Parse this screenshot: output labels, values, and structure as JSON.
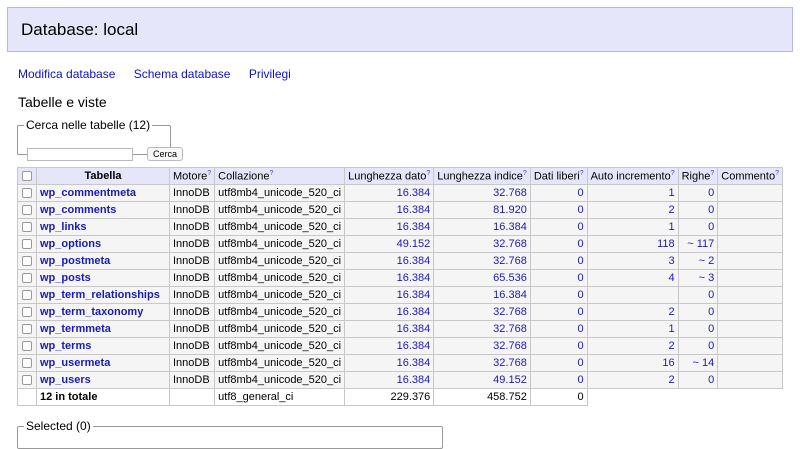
{
  "header": {
    "title": "Database: local"
  },
  "nav": {
    "modify": "Modifica database",
    "schema": "Schema database",
    "privileges": "Privilegi"
  },
  "section_title": "Tabelle e viste",
  "search": {
    "legend": "Cerca nelle tabelle (12)",
    "value": "",
    "button": "Cerca"
  },
  "table": {
    "headers": {
      "table": "Tabella",
      "engine": "Motore",
      "collation": "Collazione",
      "data_length": "Lunghezza dato",
      "index_length": "Lunghezza indice",
      "data_free": "Dati liberi",
      "auto_increment": "Auto incremento",
      "rows": "Righe",
      "comment": "Commento",
      "help": "?"
    },
    "rows": [
      {
        "name": "wp_commentmeta",
        "engine": "InnoDB",
        "collation": "utf8mb4_unicode_520_ci",
        "data": "16.384",
        "index": "32.768",
        "free": "0",
        "auto": "1",
        "rows": "0"
      },
      {
        "name": "wp_comments",
        "engine": "InnoDB",
        "collation": "utf8mb4_unicode_520_ci",
        "data": "16.384",
        "index": "81.920",
        "free": "0",
        "auto": "2",
        "rows": "0"
      },
      {
        "name": "wp_links",
        "engine": "InnoDB",
        "collation": "utf8mb4_unicode_520_ci",
        "data": "16.384",
        "index": "16.384",
        "free": "0",
        "auto": "1",
        "rows": "0"
      },
      {
        "name": "wp_options",
        "engine": "InnoDB",
        "collation": "utf8mb4_unicode_520_ci",
        "data": "49.152",
        "index": "32.768",
        "free": "0",
        "auto": "118",
        "rows": "~ 117"
      },
      {
        "name": "wp_postmeta",
        "engine": "InnoDB",
        "collation": "utf8mb4_unicode_520_ci",
        "data": "16.384",
        "index": "32.768",
        "free": "0",
        "auto": "3",
        "rows": "~ 2"
      },
      {
        "name": "wp_posts",
        "engine": "InnoDB",
        "collation": "utf8mb4_unicode_520_ci",
        "data": "16.384",
        "index": "65.536",
        "free": "0",
        "auto": "4",
        "rows": "~ 3"
      },
      {
        "name": "wp_term_relationships",
        "engine": "InnoDB",
        "collation": "utf8mb4_unicode_520_ci",
        "data": "16.384",
        "index": "16.384",
        "free": "0",
        "auto": "",
        "rows": "0"
      },
      {
        "name": "wp_term_taxonomy",
        "engine": "InnoDB",
        "collation": "utf8mb4_unicode_520_ci",
        "data": "16.384",
        "index": "32.768",
        "free": "0",
        "auto": "2",
        "rows": "0"
      },
      {
        "name": "wp_termmeta",
        "engine": "InnoDB",
        "collation": "utf8mb4_unicode_520_ci",
        "data": "16.384",
        "index": "32.768",
        "free": "0",
        "auto": "1",
        "rows": "0"
      },
      {
        "name": "wp_terms",
        "engine": "InnoDB",
        "collation": "utf8mb4_unicode_520_ci",
        "data": "16.384",
        "index": "32.768",
        "free": "0",
        "auto": "2",
        "rows": "0"
      },
      {
        "name": "wp_usermeta",
        "engine": "InnoDB",
        "collation": "utf8mb4_unicode_520_ci",
        "data": "16.384",
        "index": "32.768",
        "free": "0",
        "auto": "16",
        "rows": "~ 14"
      },
      {
        "name": "wp_users",
        "engine": "InnoDB",
        "collation": "utf8mb4_unicode_520_ci",
        "data": "16.384",
        "index": "49.152",
        "free": "0",
        "auto": "2",
        "rows": "0"
      }
    ],
    "total": {
      "label": "12 in totale",
      "collation": "utf8_general_ci",
      "data": "229.376",
      "index": "458.752",
      "free": "0"
    }
  },
  "selected": {
    "legend": "Selected (0)"
  },
  "colors": {
    "header_bg": "#e6e6fa",
    "link": "#1a1ab8",
    "row_bg": "#f5f5f5"
  }
}
